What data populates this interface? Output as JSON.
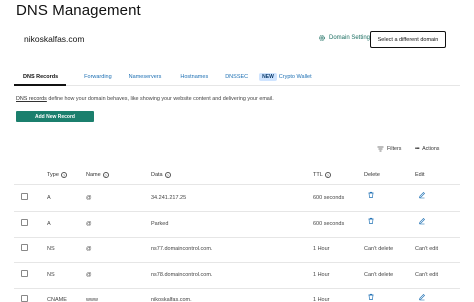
{
  "page": {
    "title": "DNS Management"
  },
  "domain_bar": {
    "domain_name": "nikoskalfas.com",
    "settings_label": "Domain Settings",
    "select_label": "Select a different domain"
  },
  "tabs": [
    {
      "label": "DNS Records",
      "active": true
    },
    {
      "label": "Forwarding",
      "active": false
    },
    {
      "label": "Nameservers",
      "active": false
    },
    {
      "label": "Hostnames",
      "active": false
    },
    {
      "label": "DNSSEC",
      "active": false
    },
    {
      "label": "Crypto Wallet",
      "active": false,
      "badge": "NEW"
    }
  ],
  "description": {
    "link_text": "DNS records",
    "rest_text": " define how your domain behaves, like showing your website content and delivering your email."
  },
  "add_button": {
    "label": "Add New Record"
  },
  "toolbar": {
    "filters_label": "Filters",
    "actions_label": "Actions"
  },
  "table": {
    "headers": {
      "type": "Type",
      "name": "Name",
      "data": "Data",
      "ttl": "TTL",
      "delete": "Delete",
      "edit": "Edit"
    },
    "rows": [
      {
        "type": "A",
        "name": "@",
        "data": "34.241.217.25",
        "ttl": "600 seconds",
        "delete": "",
        "edit": "",
        "deletable": true
      },
      {
        "type": "A",
        "name": "@",
        "data": "Parked",
        "ttl": "600 seconds",
        "delete": "",
        "edit": "",
        "deletable": true
      },
      {
        "type": "NS",
        "name": "@",
        "data": "ns77.domaincontrol.com.",
        "ttl": "1 Hour",
        "delete": "Can't delete",
        "edit": "Can't edit",
        "deletable": false
      },
      {
        "type": "NS",
        "name": "@",
        "data": "ns78.domaincontrol.com.",
        "ttl": "1 Hour",
        "delete": "Can't delete",
        "edit": "Can't edit",
        "deletable": false
      },
      {
        "type": "CNAME",
        "name": "www",
        "data": "nikoskalfas.com.",
        "ttl": "1 Hour",
        "delete": "",
        "edit": "",
        "deletable": true
      }
    ]
  },
  "colors": {
    "accent_green": "#1b7f6d",
    "link_blue": "#1c6fb3",
    "icon_blue": "#1c6fb3"
  }
}
